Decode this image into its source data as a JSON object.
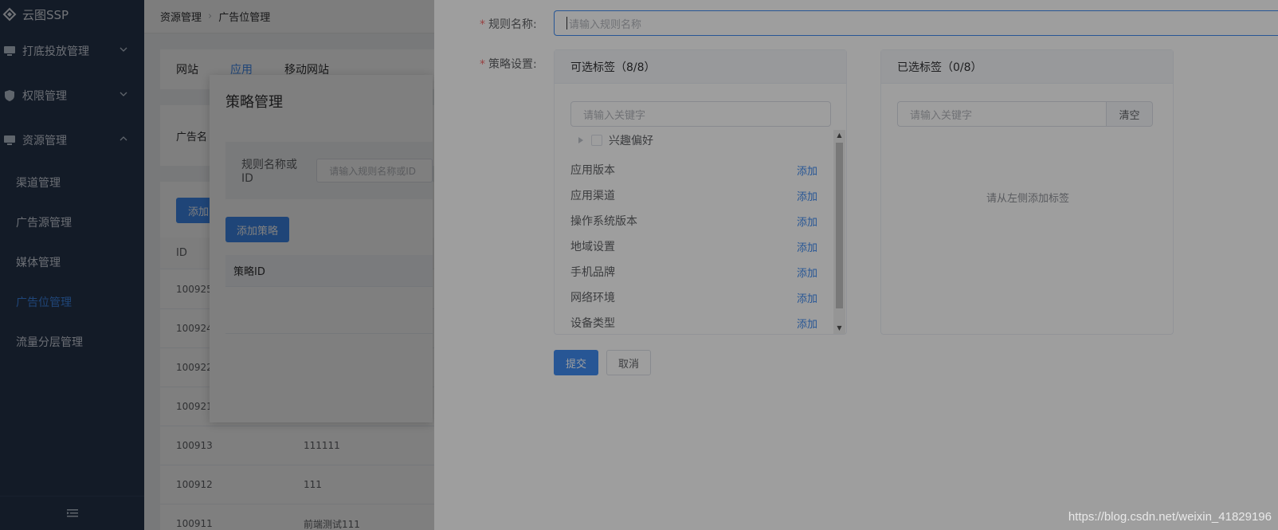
{
  "app": {
    "title": "云图SSP"
  },
  "sidebar": {
    "groups": [
      {
        "label": "打底投放管理",
        "icon": "monitor-icon",
        "expanded": false
      },
      {
        "label": "权限管理",
        "icon": "shield-icon",
        "expanded": false
      },
      {
        "label": "资源管理",
        "icon": "monitor-icon",
        "expanded": true
      }
    ],
    "items": [
      {
        "label": "渠道管理",
        "active": false
      },
      {
        "label": "广告源管理",
        "active": false
      },
      {
        "label": "媒体管理",
        "active": false
      },
      {
        "label": "广告位管理",
        "active": true
      },
      {
        "label": "流量分层管理",
        "active": false
      }
    ],
    "collapse_icon": "menu-collapse-icon"
  },
  "breadcrumb": [
    "资源管理",
    "广告位管理"
  ],
  "bg_tabs": [
    "网站",
    "应用",
    "移动网站"
  ],
  "bg_tab_active": "应用",
  "bg_filter_label": "广告名",
  "bg_add_label": "添加",
  "bg_table": {
    "header": "ID",
    "rows": [
      {
        "id": "100925",
        "name": ""
      },
      {
        "id": "100924",
        "name": ""
      },
      {
        "id": "100922",
        "name": ""
      },
      {
        "id": "100921",
        "name": ""
      },
      {
        "id": "100913",
        "name": "111111"
      },
      {
        "id": "100912",
        "name": "111"
      },
      {
        "id": "100911",
        "name": "前端测试111"
      }
    ]
  },
  "strategy_dialog": {
    "title": "策略管理",
    "filter_label": "规则名称或ID",
    "filter_placeholder": "请输入规则名称或ID",
    "add_button": "添加策略",
    "table_header": "策略ID"
  },
  "drawer": {
    "name_label": "规则名称:",
    "name_placeholder": "请输入规则名称",
    "strategy_label": "策略设置:",
    "available": {
      "title": "可选标签（8/8）",
      "search_placeholder": "请输入关键字",
      "tree_node": "兴趣偏好",
      "tags": [
        "应用版本",
        "应用渠道",
        "操作系统版本",
        "地域设置",
        "手机品牌",
        "网络环境",
        "设备类型"
      ],
      "add_label": "添加"
    },
    "selected": {
      "title": "已选标签（0/8）",
      "search_placeholder": "请输入关键字",
      "clear_button": "清空",
      "empty_text": "请从左侧添加标签"
    },
    "submit_button": "提交",
    "cancel_button": "取消"
  },
  "watermark": "https://blog.csdn.net/weixin_41829196",
  "colors": {
    "sidebar_bg": "#26364f",
    "primary": "#3f8bf0",
    "active_menu": "#3f8bf0",
    "required": "#f56c6c"
  }
}
